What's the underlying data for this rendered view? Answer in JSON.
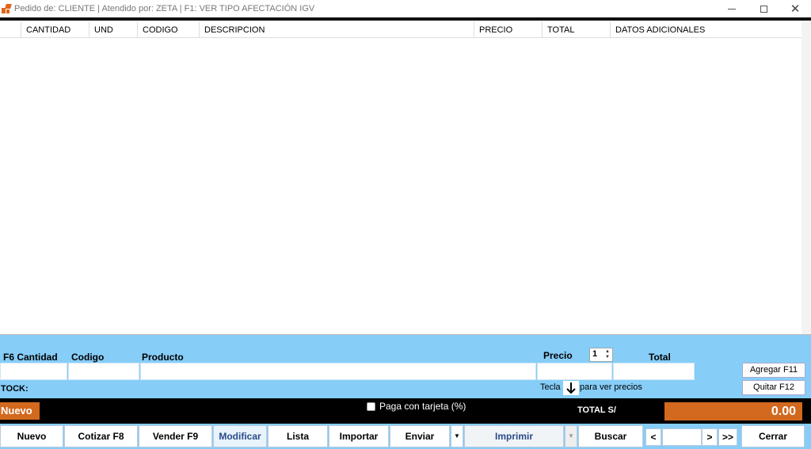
{
  "window": {
    "title": "Pedido de: CLIENTE | Atendido por: ZETA | F1: VER TIPO AFECTACIÓN IGV"
  },
  "grid": {
    "columns": [
      "CANTIDAD",
      "UND",
      "CODIGO",
      "DESCRIPCION",
      "PRECIO",
      "TOTAL",
      "DATOS ADICIONALES"
    ],
    "rows": []
  },
  "entry": {
    "cantidad_label": "F6 Cantidad",
    "codigo_label": "Codigo",
    "producto_label": "Producto",
    "precio_label": "Precio",
    "precio_list_value": "1",
    "total_label": "Total",
    "stock_label": "TOCK:",
    "tecla_label": "Tecla",
    "ver_precios_label": "para ver precios",
    "agregar_label": "Agregar F11",
    "quitar_label": "Quitar F12"
  },
  "status": {
    "mode_badge": "Nuevo",
    "paga_tarjeta_label": "Paga con tarjeta (%)",
    "total_label": "TOTAL S/",
    "total_value": "0.00"
  },
  "toolbar": {
    "nuevo": "Nuevo",
    "cotizar": "Cotizar F8",
    "vender": "Vender F9",
    "modificar": "Modificar",
    "lista": "Lista",
    "importar": "Importar",
    "enviar": "Enviar",
    "imprimir": "Imprimir",
    "buscar": "Buscar",
    "prev": "<",
    "next": ">",
    "last": ">>",
    "cerrar": "Cerrar"
  },
  "colors": {
    "panel_blue": "#86cdf8",
    "accent_orange": "#d2691e"
  }
}
